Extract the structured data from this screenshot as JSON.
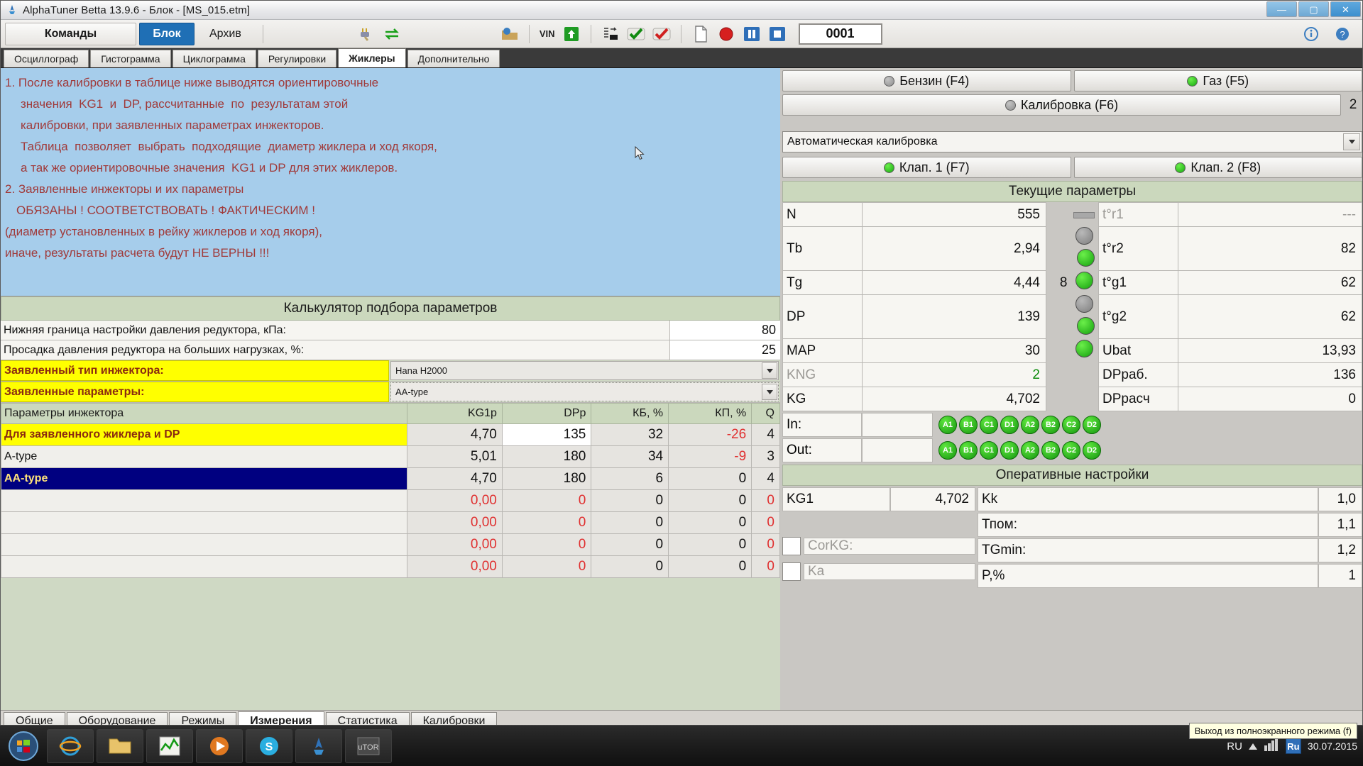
{
  "window": {
    "title": "AlphaTuner Betta 13.9.6 - Блок - [MS_015.etm]",
    "minimize": "—",
    "maximize": "▢",
    "close": "✕"
  },
  "menubar": {
    "commands": "Команды",
    "block": "Блок",
    "archive": "Архив",
    "counter_value": "0001",
    "icons": [
      "plug-icon",
      "swap-icon",
      "folder-open-icon",
      "vin-label",
      "upload-green-icon",
      "list-export-icon",
      "check-green-icon",
      "check-red-icon",
      "new-doc-icon",
      "record-red-icon",
      "pause-blue-icon",
      "stop-blue-icon",
      "info-icon",
      "help-icon"
    ],
    "vin_label": "VIN"
  },
  "tabs": {
    "items": [
      {
        "label": "Осциллограф",
        "selected": false
      },
      {
        "label": "Гистограмма",
        "selected": false
      },
      {
        "label": "Циклограмма",
        "selected": false
      },
      {
        "label": "Регулировки",
        "selected": false
      },
      {
        "label": "Жиклеры",
        "selected": true
      },
      {
        "label": "Дополнительно",
        "selected": false
      }
    ]
  },
  "info_panel": {
    "lines": [
      "1. После калибровки в таблице ниже выводятся ориентировочные",
      "значения  KG1  и  DP, рассчитанные  по  результатам этой",
      "калибровки, при заявленных параметрах инжекторов.",
      "Таблица  позволяет  выбрать  подходящие  диаметр жиклера и ход якоря,",
      "а так же ориентировочные значения  KG1 и DP для этих жиклеров.",
      "2. Заявленные инжекторы и их параметры",
      "ОБЯЗАНЫ ! СООТВЕТСТВОВАТЬ ! ФАКТИЧЕСКИМ !",
      "(диаметр установленных в рейку жиклеров и ход якоря),",
      "иначе, результаты расчета будут НЕ ВЕРНЫ !!!"
    ]
  },
  "calculator": {
    "title": "Калькулятор подбора параметров",
    "rows": [
      {
        "label": "Нижняя граница настройки давления редуктора, кПа:",
        "value": "80"
      },
      {
        "label": "Просадка давления редуктора на больших нагрузках, %:",
        "value": "25"
      }
    ],
    "injector_type_label": "Заявленный тип инжектора:",
    "injector_type_value": "Hana H2000",
    "params_label": "Заявленные параметры:",
    "params_value": "AA-type"
  },
  "data_table": {
    "headers": [
      "Параметры инжектора",
      "KG1p",
      "DPp",
      "КБ, %",
      "КП, %",
      "Q"
    ],
    "rows": [
      {
        "name": "Для заявленного жиклера и DP",
        "kg1p": "4,70",
        "dpp": "135",
        "kb": "32",
        "kp": "-26",
        "q": "4",
        "style": "highlight",
        "dpp_white": true,
        "kp_red": true
      },
      {
        "name": "A-type",
        "kg1p": "5,01",
        "dpp": "180",
        "kb": "34",
        "kp": "-9",
        "q": "3",
        "style": "normal",
        "kp_red": true
      },
      {
        "name": "AA-type",
        "kg1p": "4,70",
        "dpp": "180",
        "kb": "6",
        "kp": "0",
        "q": "4",
        "style": "selected"
      },
      {
        "name": "",
        "kg1p": "0,00",
        "dpp": "0",
        "kb": "0",
        "kp": "0",
        "q": "0",
        "style": "empty",
        "all_red": true
      },
      {
        "name": "",
        "kg1p": "0,00",
        "dpp": "0",
        "kb": "0",
        "kp": "0",
        "q": "0",
        "style": "empty",
        "all_red": true
      },
      {
        "name": "",
        "kg1p": "0,00",
        "dpp": "0",
        "kb": "0",
        "kp": "0",
        "q": "0",
        "style": "empty",
        "all_red": true
      },
      {
        "name": "",
        "kg1p": "0,00",
        "dpp": "0",
        "kb": "0",
        "kp": "0",
        "q": "0",
        "style": "empty",
        "all_red": true
      }
    ]
  },
  "right_panel": {
    "fuel_buttons": [
      {
        "label": "Бензин  (F4)",
        "led": "grey"
      },
      {
        "label": "Газ   (F5)",
        "led": "green"
      }
    ],
    "calibration_button": {
      "label": "Калибровка  (F6)",
      "led": "grey",
      "badge": "2"
    },
    "mode_select": "Автоматическая калибровка",
    "valve_buttons": [
      {
        "label": "Клап. 1 (F7)",
        "led": "green"
      },
      {
        "label": "Клап. 2 (F8)",
        "led": "green"
      }
    ],
    "current_params_title": "Текущие параметры",
    "left_params": [
      {
        "key": "N",
        "value": "555"
      },
      {
        "key": "Tb",
        "value": "2,94"
      },
      {
        "key": "Tg",
        "value": "4,44"
      },
      {
        "key": "DP",
        "value": "139"
      },
      {
        "key": "MAP",
        "value": "30"
      },
      {
        "key": "KNG",
        "value": "2",
        "dim": true
      },
      {
        "key": "KG",
        "value": "4,702"
      }
    ],
    "mid_extra": {
      "tg_num": "8"
    },
    "right_params": [
      {
        "key": "t°r1",
        "value": "---",
        "led": "bar",
        "dim": true
      },
      {
        "key": "t°r2",
        "value": "82",
        "led": "green"
      },
      {
        "key": "t°g1",
        "value": "62",
        "led": "green"
      },
      {
        "key": "t°g2",
        "value": "62",
        "led": "green"
      },
      {
        "key": "Ubat",
        "value": "13,93",
        "led": "green"
      },
      {
        "key": "DPраб.",
        "value": "136"
      },
      {
        "key": "DPрасч",
        "value": "0"
      }
    ],
    "led_col": [
      "grey",
      "green",
      "green",
      "grey",
      "green"
    ],
    "io_rows": [
      {
        "label": "In:",
        "value": "",
        "chips": [
          "A1",
          "B1",
          "C1",
          "D1",
          "A2",
          "B2",
          "C2",
          "D2"
        ]
      },
      {
        "label": "Out:",
        "value": "",
        "chips": [
          "A1",
          "B1",
          "C1",
          "D1",
          "A2",
          "B2",
          "C2",
          "D2"
        ]
      }
    ],
    "operative_title": "Оперативные настройки",
    "operative_left": [
      {
        "key": "KG1",
        "value": "4,702"
      },
      {
        "key": "CorKG:",
        "value": "",
        "checkbox": true,
        "dim": true
      },
      {
        "key": "Ka",
        "value": "",
        "checkbox": true,
        "dim": true
      }
    ],
    "operative_right": [
      {
        "key": "Kk",
        "value": "1,0"
      },
      {
        "key": "Тпом:",
        "value": "1,1"
      },
      {
        "key": "TGmin:",
        "value": "1,2"
      },
      {
        "key": "P,%",
        "value": "1"
      }
    ]
  },
  "bottom_tabs": {
    "items": [
      {
        "label": "Общие",
        "selected": false
      },
      {
        "label": "Оборудование",
        "selected": false
      },
      {
        "label": "Режимы",
        "selected": false
      },
      {
        "label": "Измерения",
        "selected": true
      },
      {
        "label": "Статистика",
        "selected": false
      },
      {
        "label": "Калибровки",
        "selected": false
      }
    ]
  },
  "taskbar": {
    "start": "start-orb-icon",
    "apps": [
      "internet-explorer-icon",
      "file-manager-icon",
      "chart-green-icon",
      "media-player-icon",
      "skype-icon",
      "alphatuner-icon",
      "utorrent-icon"
    ],
    "language": "RU",
    "lang_badge": "Ru",
    "tooltip": "Выход из полноэкранного режима (f)",
    "date": "30.07.2015"
  }
}
